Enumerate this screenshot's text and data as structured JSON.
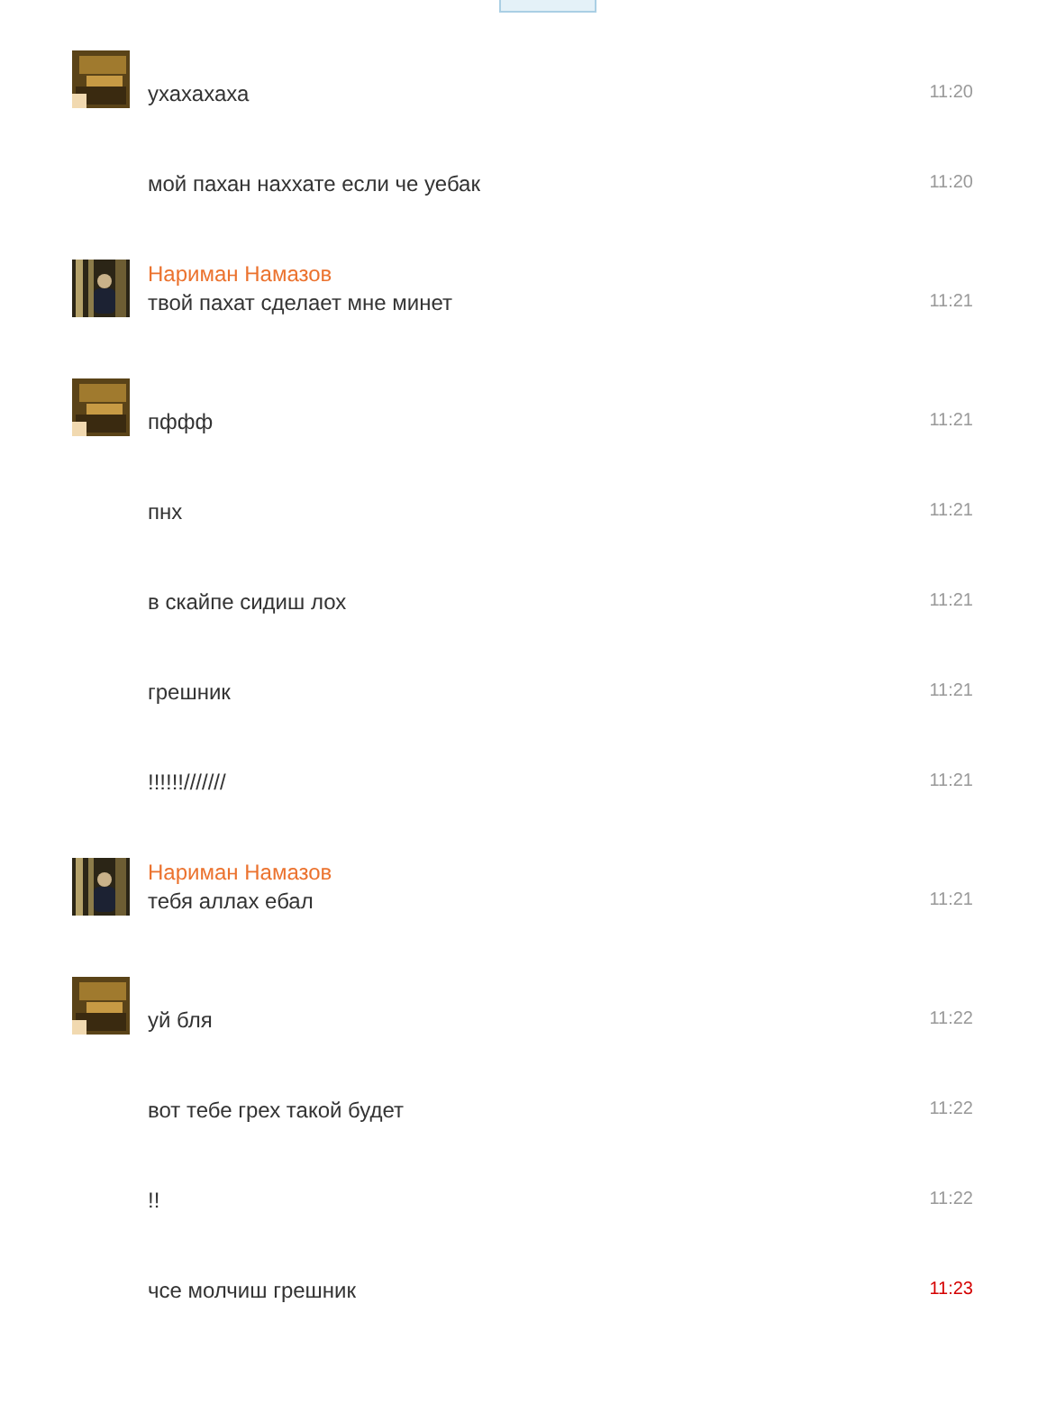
{
  "groups": [
    {
      "kind": "self",
      "messages": [
        {
          "text": "ухахахаха",
          "time": "11:20",
          "unread": false
        },
        {
          "text": "мой пахан наххате если че уебак",
          "time": "11:20",
          "unread": false
        }
      ]
    },
    {
      "kind": "other",
      "author": "Нариман Намазов",
      "messages": [
        {
          "text": "твой пахат сделает мне минет",
          "time": "11:21",
          "unread": false
        }
      ]
    },
    {
      "kind": "self",
      "messages": [
        {
          "text": "пффф",
          "time": "11:21",
          "unread": false
        },
        {
          "text": "пнх",
          "time": "11:21",
          "unread": false
        },
        {
          "text": "в скайпе сидиш лох",
          "time": "11:21",
          "unread": false
        },
        {
          "text": "грешник",
          "time": "11:21",
          "unread": false
        },
        {
          "text": "!!!!!!///////",
          "time": "11:21",
          "unread": false
        }
      ]
    },
    {
      "kind": "other",
      "author": "Нариман Намазов",
      "messages": [
        {
          "text": "тебя аллах ебал",
          "time": "11:21",
          "unread": false
        }
      ]
    },
    {
      "kind": "self",
      "messages": [
        {
          "text": "уй бля",
          "time": "11:22",
          "unread": false
        },
        {
          "text": "вот тебе грех такой будет",
          "time": "11:22",
          "unread": false
        },
        {
          "text": "!!",
          "time": "11:22",
          "unread": false
        },
        {
          "text": "чсе молчиш грешник",
          "time": "11:23",
          "unread": true
        }
      ]
    }
  ]
}
